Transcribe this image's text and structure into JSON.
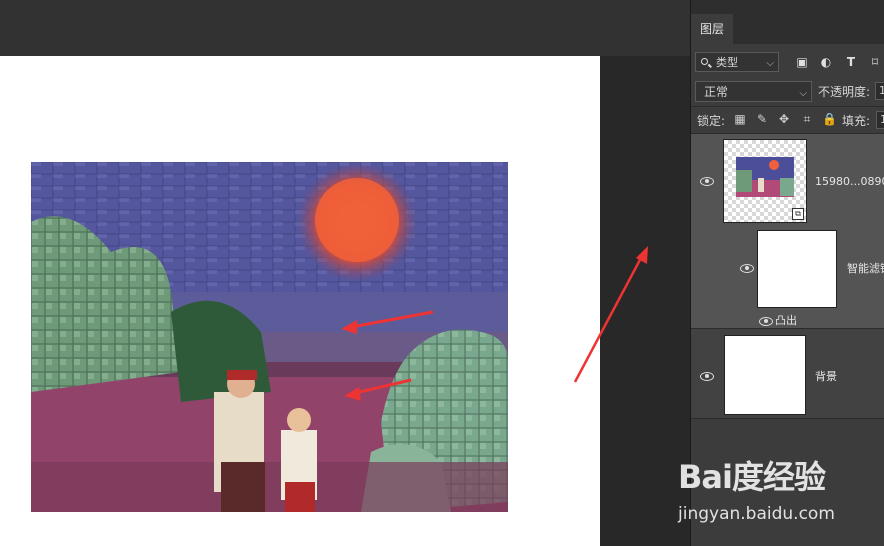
{
  "panel": {
    "tab_label": "图层",
    "filter_label": "类型",
    "blend_mode": "正常",
    "opacity_label": "不透明度:",
    "opacity_value": "1",
    "lock_label": "锁定:",
    "fill_label": "填充:",
    "fill_value": "1"
  },
  "layers": [
    {
      "name": "15980...0890",
      "smart_filters_label": "智能滤镜",
      "filter_name": "凸出"
    },
    {
      "name": "背景"
    }
  ],
  "icons": {
    "filter_icons": [
      "image-icon",
      "adjustment-icon",
      "type-icon",
      "shape-icon"
    ],
    "lock_icons": [
      "lock-transparent-icon",
      "lock-paint-icon",
      "lock-move-icon",
      "lock-artboard-icon",
      "lock-all-icon"
    ]
  },
  "watermark": {
    "logo_text": "Bai度经验",
    "url": "jingyan.baidu.com"
  },
  "colors": {
    "annotation_arrow": "#ee3333",
    "panel_bg": "#3c3c3c",
    "workspace_bg": "#282828"
  }
}
